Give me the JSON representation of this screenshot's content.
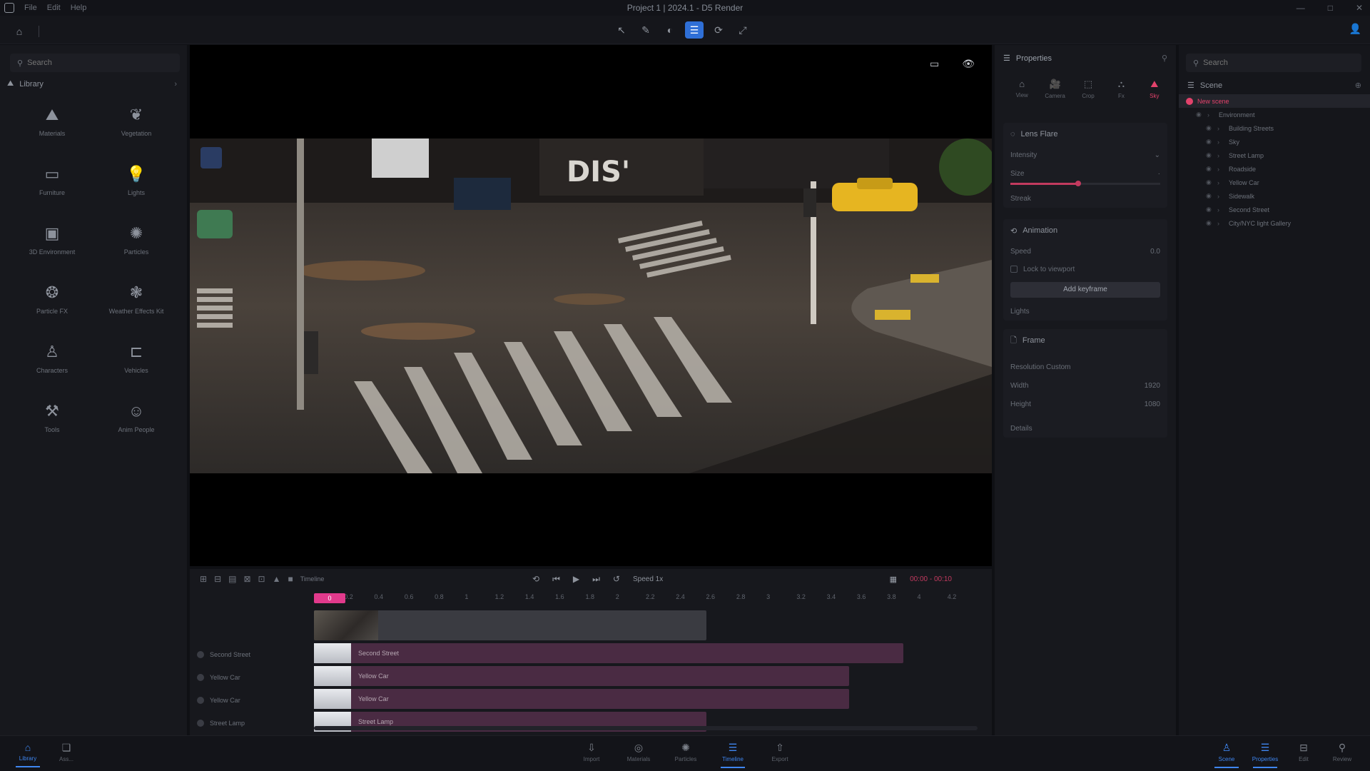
{
  "titlebar": {
    "title": "Project 1 | 2024.1 - D5 Render",
    "menu": [
      "File",
      "Edit",
      "Help"
    ],
    "controls": [
      "—",
      "□",
      "✕"
    ]
  },
  "toolbar": {
    "left_icons": [
      "home-icon",
      "divider"
    ],
    "center_tools": [
      {
        "name": "select-tool",
        "glyph": "↖",
        "active": false
      },
      {
        "name": "brush-tool",
        "glyph": "✎",
        "active": false
      },
      {
        "name": "sphere-tool",
        "glyph": "◐",
        "active": false
      },
      {
        "name": "align-tool",
        "glyph": "☰",
        "active": true
      },
      {
        "name": "rotate-tool",
        "glyph": "⟳",
        "active": false
      },
      {
        "name": "scale-tool",
        "glyph": "⤢",
        "active": false
      }
    ],
    "user_icon": "👤"
  },
  "library": {
    "search_placeholder": "Search",
    "section_title": "Library",
    "items": [
      {
        "label": "Materials",
        "glyph": "⛰"
      },
      {
        "label": "Vegetation",
        "glyph": "❦"
      },
      {
        "label": "Furniture",
        "glyph": "▭"
      },
      {
        "label": "Lights",
        "glyph": "💡"
      },
      {
        "label": "3D Environment",
        "glyph": "▣"
      },
      {
        "label": "Particles",
        "glyph": "✺"
      },
      {
        "label": "Particle FX",
        "glyph": "❂"
      },
      {
        "label": "Weather Effects Kit",
        "glyph": "❃"
      },
      {
        "label": "Characters",
        "glyph": "♙"
      },
      {
        "label": "Vehicles",
        "glyph": "⊏"
      },
      {
        "label": "Tools",
        "glyph": "⚒"
      },
      {
        "label": "Anim People",
        "glyph": "☺"
      }
    ]
  },
  "viewport": {
    "icons": [
      "layout-icon",
      "preview-eye-icon"
    ]
  },
  "properties": {
    "title": "Properties",
    "tabs": [
      {
        "label": "View",
        "glyph": "⌂",
        "active": false
      },
      {
        "label": "Camera",
        "glyph": "🎥",
        "active": false
      },
      {
        "label": "Crop",
        "glyph": "⬚",
        "active": false
      },
      {
        "label": "Fx",
        "glyph": "⛬",
        "active": false
      },
      {
        "label": "Sky",
        "glyph": "⛰",
        "active": true
      }
    ],
    "card1": {
      "title": "Lens Flare",
      "row1_label": "Intensity",
      "row2_label": "Size",
      "slider_value": 0.45,
      "row3_label": "Streak"
    },
    "card2": {
      "title": "Animation",
      "row1_label": "Speed",
      "row1_value": "0.0",
      "checkbox_label": "Lock to viewport",
      "button_label": "Add keyframe"
    },
    "collapse1": "Lights",
    "card3": {
      "title": "Frame",
      "sub": "Resolution  Custom",
      "width_label": "Width",
      "width_value": "1920",
      "height_label": "Height",
      "height_value": "1080"
    },
    "collapse2": "Details"
  },
  "outline": {
    "search_placeholder": "Search",
    "title": "Scene",
    "items": [
      {
        "label": "New scene",
        "selected": true,
        "indent": 0
      },
      {
        "label": "Environment",
        "selected": false,
        "indent": 1
      },
      {
        "label": "Building Streets",
        "selected": false,
        "indent": 2
      },
      {
        "label": "Sky",
        "selected": false,
        "indent": 2
      },
      {
        "label": "Street Lamp",
        "selected": false,
        "indent": 2
      },
      {
        "label": "Roadside",
        "selected": false,
        "indent": 2
      },
      {
        "label": "Yellow Car",
        "selected": false,
        "indent": 2
      },
      {
        "label": "Sidewalk",
        "selected": false,
        "indent": 2
      },
      {
        "label": "Second Street",
        "selected": false,
        "indent": 2
      },
      {
        "label": "City/NYC light Gallery",
        "selected": false,
        "indent": 2
      }
    ]
  },
  "timeline": {
    "tools": [
      "⊞",
      "⊟",
      "▤",
      "⊠",
      "⊡",
      "▲",
      "■"
    ],
    "clip_name": "Timeline",
    "transport": [
      "⟲",
      "⏮",
      "▶",
      "⏭",
      "↺"
    ],
    "speed": "Speed 1x",
    "grid_icon": "▦",
    "range_label": "00:00 - 00:10",
    "ruler": [
      "0",
      "0.2",
      "0.4",
      "0.6",
      "0.8",
      "1",
      "1.2",
      "1.4",
      "1.6",
      "1.8",
      "2",
      "2.2",
      "2.4",
      "2.6",
      "2.8",
      "3",
      "3.2",
      "3.4",
      "3.6",
      "3.8",
      "4",
      "4.2"
    ],
    "playhead": "0",
    "tracks": [
      {
        "label": "Second Street",
        "clip": "Second Street"
      },
      {
        "label": "Yellow Car",
        "clip": "Yellow Car"
      },
      {
        "label": "Yellow Car",
        "clip": "Yellow Car"
      },
      {
        "label": "Street Lamp",
        "clip": "Street Lamp"
      }
    ]
  },
  "bottombar": {
    "left": [
      {
        "label": "Library",
        "glyph": "⌂",
        "active": true
      },
      {
        "label": "Ass...",
        "glyph": "❏",
        "active": false
      }
    ],
    "center": [
      {
        "label": "Import",
        "glyph": "⇩",
        "active": false
      },
      {
        "label": "Materials",
        "glyph": "◎",
        "active": false
      },
      {
        "label": "Particles",
        "glyph": "✺",
        "active": false
      },
      {
        "label": "Timeline",
        "glyph": "☰",
        "active": true
      },
      {
        "label": "Export",
        "glyph": "⇧",
        "active": false
      }
    ],
    "right": [
      {
        "label": "Scene",
        "glyph": "♙",
        "active": true
      },
      {
        "label": "Properties",
        "glyph": "☰",
        "active": true
      },
      {
        "label": "Edit",
        "glyph": "⊟",
        "active": false
      },
      {
        "label": "Review",
        "glyph": "⚲",
        "active": false
      }
    ]
  }
}
